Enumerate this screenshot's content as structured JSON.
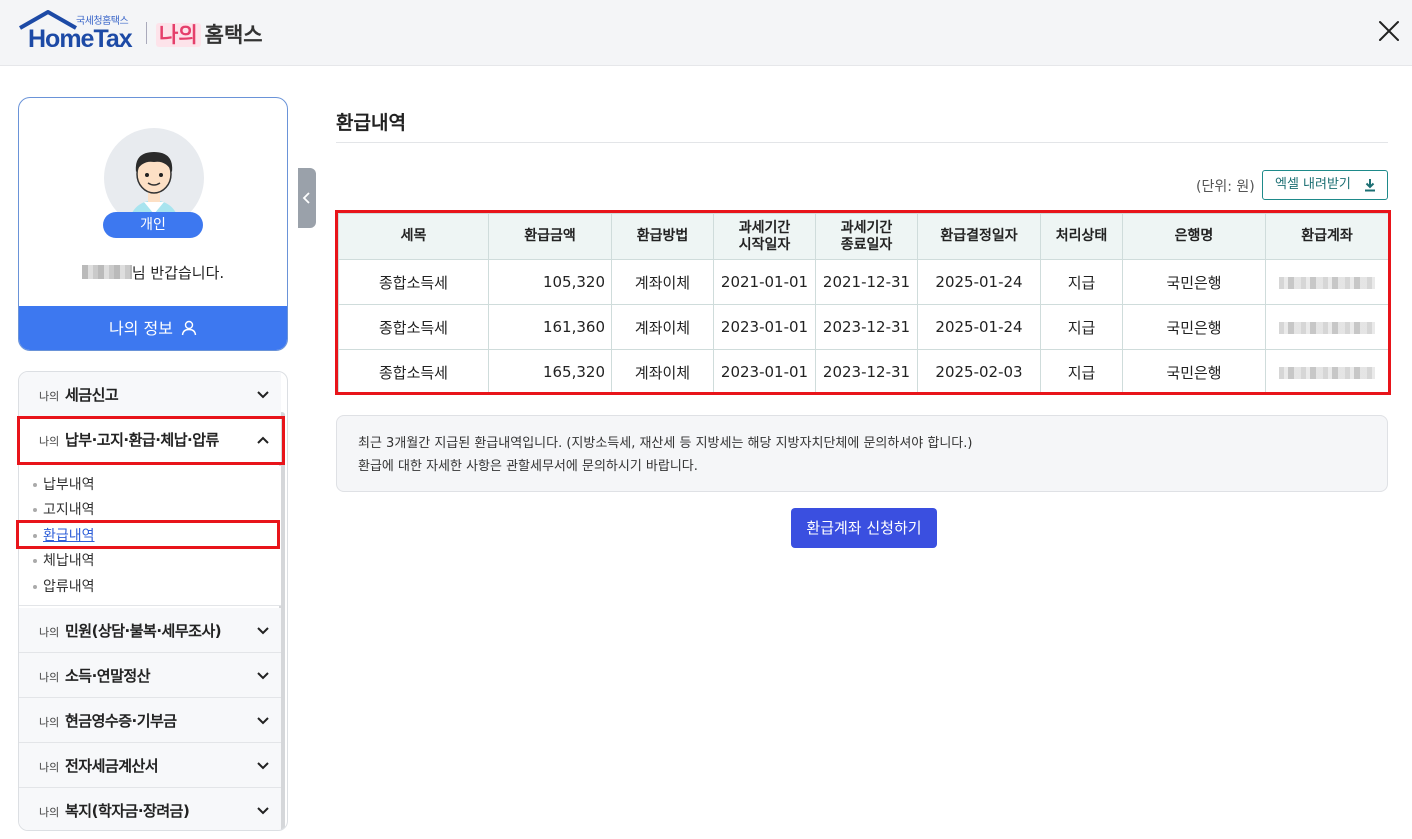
{
  "header": {
    "logo_small": "국세청홈택스",
    "logo_main": "HomeTax",
    "brand_mine": "나의",
    "brand_home": "홈택스"
  },
  "profile": {
    "badge": "개인",
    "greeting_suffix": "님 반갑습니다.",
    "my_info": "나의 정보"
  },
  "menu": {
    "prefix": "나의",
    "items": [
      {
        "label": "세금신고"
      },
      {
        "label": "납부·고지·환급·체납·압류"
      },
      {
        "label": "민원(상담·불복·세무조사)"
      },
      {
        "label": "소득·연말정산"
      },
      {
        "label": "현금영수증·기부금"
      },
      {
        "label": "전자세금계산서"
      },
      {
        "label": "복지(학자금·장려금)"
      }
    ],
    "sub_items": [
      "납부내역",
      "고지내역",
      "환급내역",
      "체납내역",
      "압류내역"
    ],
    "active_sub": "환급내역"
  },
  "main": {
    "title": "환급내역",
    "unit": "(단위: 원)",
    "excel_button": "엑셀 내려받기",
    "table": {
      "headers": [
        "세목",
        "환급금액",
        "환급방법",
        "과세기간 시작일자",
        "과세기간 종료일자",
        "환급결정일자",
        "처리상태",
        "은행명",
        "환급계좌"
      ],
      "rows": [
        [
          "종합소득세",
          "105,320",
          "계좌이체",
          "2021-01-01",
          "2021-12-31",
          "2025-01-24",
          "지급",
          "국민은행"
        ],
        [
          "종합소득세",
          "161,360",
          "계좌이체",
          "2023-01-01",
          "2023-12-31",
          "2025-01-24",
          "지급",
          "국민은행"
        ],
        [
          "종합소득세",
          "165,320",
          "계좌이체",
          "2023-01-01",
          "2023-12-31",
          "2025-02-03",
          "지급",
          "국민은행"
        ]
      ]
    },
    "notice_lines": [
      "최근 3개월간 지급된 환급내역입니다. (지방소득세, 재산세 등 지방세는 해당 지방자치단체에 문의하셔야 합니다.)",
      "환급에 대한 자세한 사항은 관할세무서에 문의하시기 바랍니다."
    ],
    "apply_button": "환급계좌 신청하기"
  },
  "colors": {
    "accent_blue": "#3d78f0",
    "button_indigo": "#3a4fe0",
    "highlight_red": "#e8141a",
    "table_header_bg": "#eef5f4"
  }
}
